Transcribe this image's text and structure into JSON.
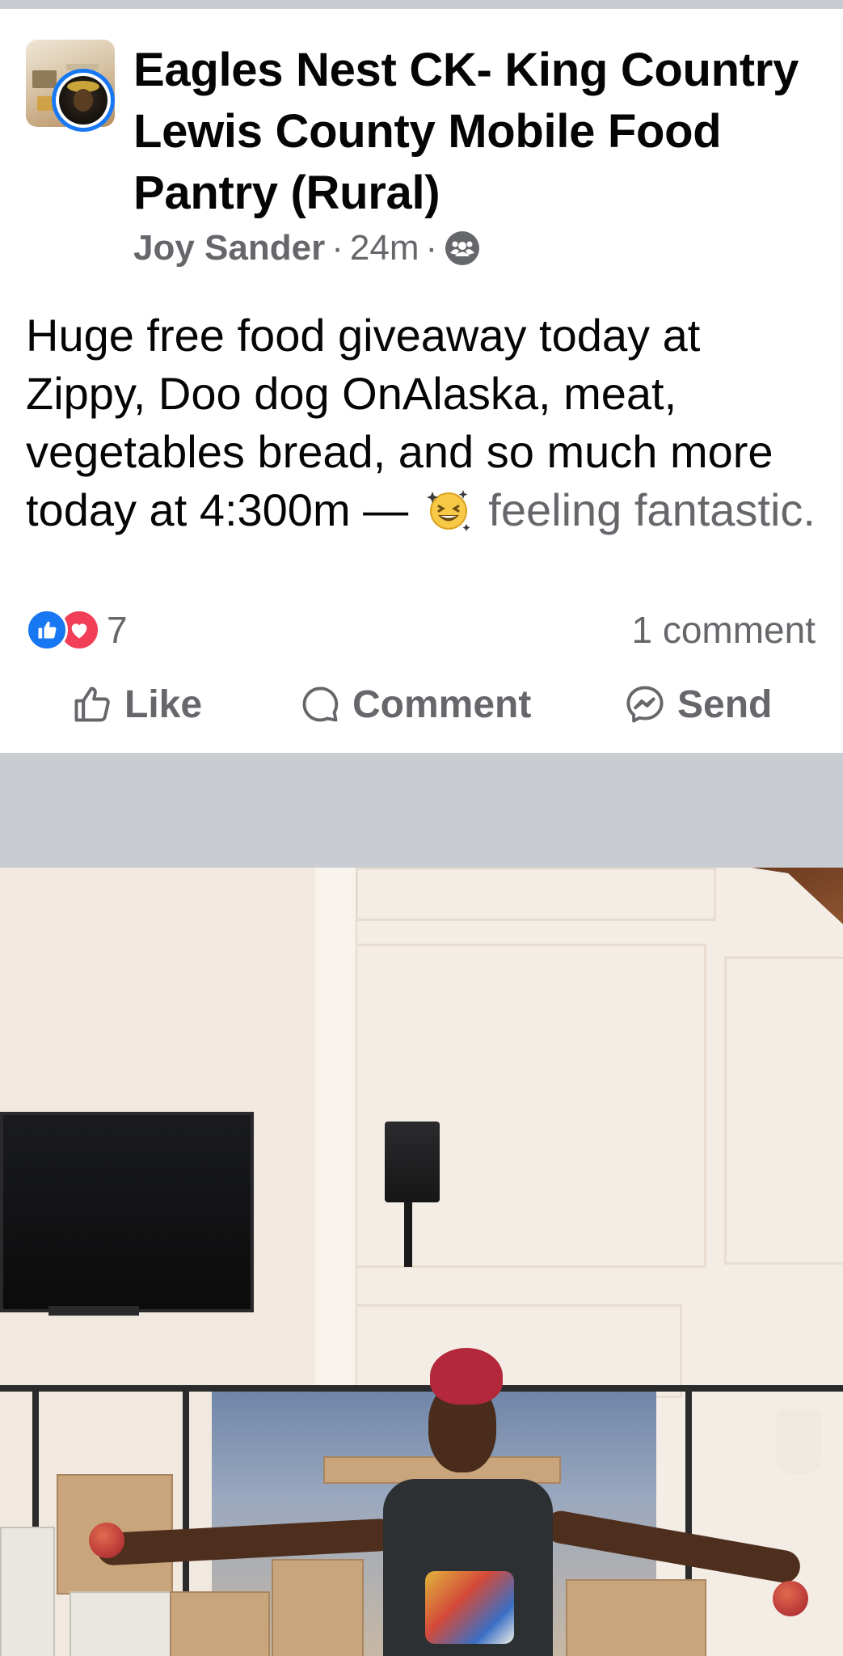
{
  "post": {
    "group_name": "Eagles Nest CK- King Country Lewis County Mobile Food Pantry (Rural)",
    "author": "Joy Sander",
    "separator": "·",
    "time": "24m",
    "audience_icon": "group-icon",
    "text": "Huge free food giveaway today at Zippy, Doo dog OnAlaska,  meat, vegetables bread, and so much more today at 4:300m —",
    "feeling_emoji": "grinning-squint-sparkle-emoji",
    "feeling": "feeling fantastic.",
    "reactions": {
      "icons": [
        "like-reaction-icon",
        "love-reaction-icon"
      ],
      "count": "7"
    },
    "comments": "1 comment"
  },
  "actions": {
    "like_label": "Like",
    "comment_label": "Comment",
    "send_label": "Send"
  },
  "colors": {
    "accent": "#1877f2",
    "love": "#f33e58",
    "secondary_text": "#65676b",
    "primary_text": "#050505",
    "divider": "#c9ccd1"
  }
}
